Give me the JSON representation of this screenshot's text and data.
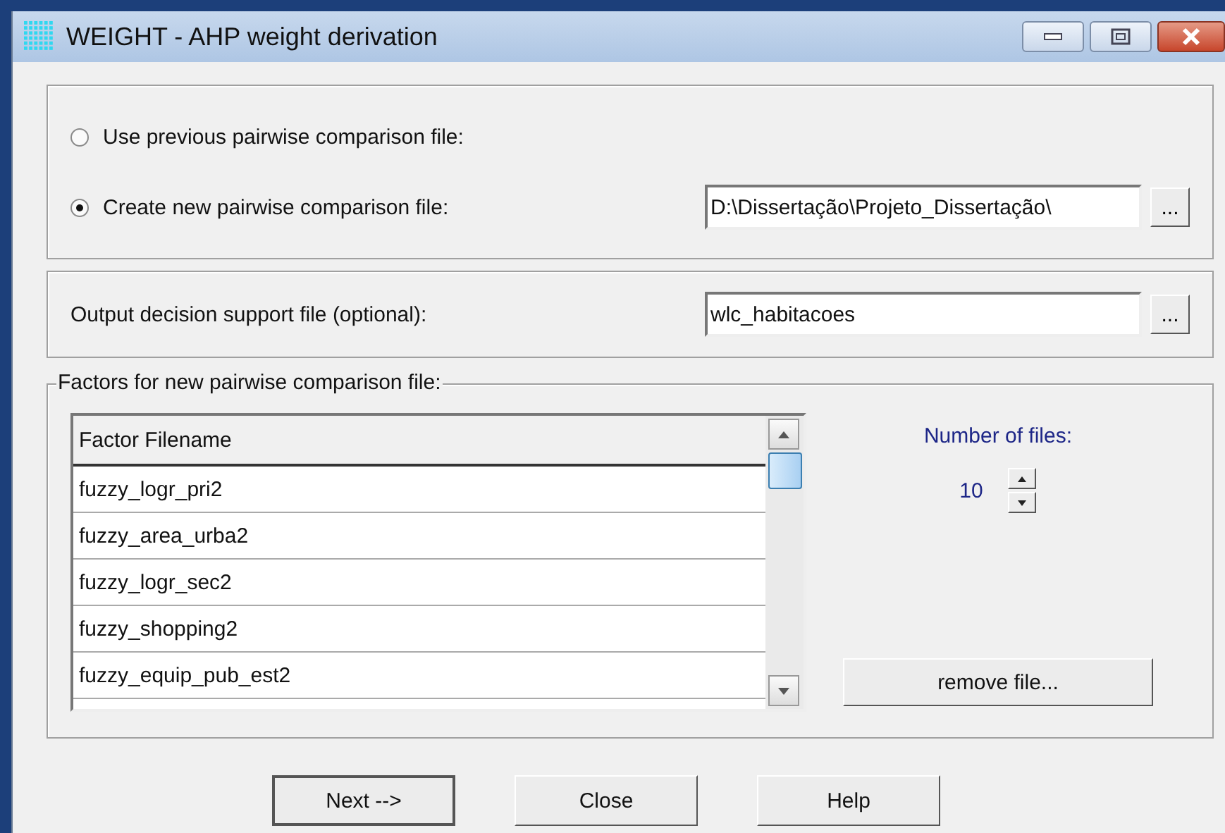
{
  "window": {
    "title": "WEIGHT - AHP weight derivation"
  },
  "source": {
    "options": [
      {
        "label": "Use previous pairwise comparison file:",
        "selected": false
      },
      {
        "label": "Create new pairwise comparison file:",
        "selected": true
      }
    ],
    "path_value": "D:\\Dissertação\\Projeto_Dissertação\\",
    "browse_label": "..."
  },
  "output": {
    "label": "Output decision support file (optional):",
    "value": "wlc_habitacoes",
    "browse_label": "..."
  },
  "factors": {
    "legend": "Factors for new pairwise comparison file:",
    "column": "Factor Filename",
    "rows": [
      "fuzzy_logr_pri2",
      "fuzzy_area_urba2",
      "fuzzy_logr_sec2",
      "fuzzy_shopping2",
      "fuzzy_equip_pub_est2"
    ],
    "count_label": "Number of files:",
    "count": "10",
    "remove_button": "remove file..."
  },
  "buttons": [
    {
      "label": "Next -->",
      "default": true
    },
    {
      "label": "Close",
      "default": false
    },
    {
      "label": "Help",
      "default": false
    }
  ]
}
